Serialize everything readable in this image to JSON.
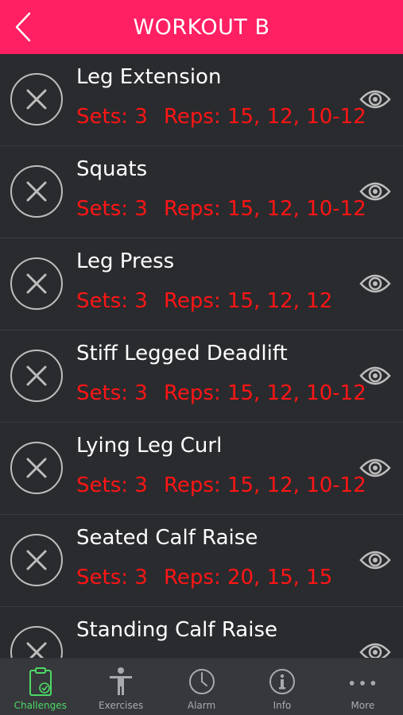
{
  "header": {
    "title": "WORKOUT B",
    "color": "#ff1f63"
  },
  "exercises": [
    {
      "name": "Leg Extension",
      "sets": "Sets: 3",
      "reps": "Reps: 15, 12, 10-12"
    },
    {
      "name": "Squats",
      "sets": "Sets: 3",
      "reps": "Reps: 15, 12, 10-12"
    },
    {
      "name": "Leg Press",
      "sets": "Sets: 3",
      "reps": "Reps: 15, 12, 12"
    },
    {
      "name": "Stiff Legged Deadlift",
      "sets": "Sets: 3",
      "reps": "Reps: 15, 12, 10-12"
    },
    {
      "name": "Lying Leg Curl",
      "sets": "Sets: 3",
      "reps": "Reps: 15, 12, 10-12"
    },
    {
      "name": "Seated Calf Raise",
      "sets": "Sets: 3",
      "reps": "Reps: 20, 15, 15"
    },
    {
      "name": "Standing Calf Raise",
      "sets": "",
      "reps": ""
    }
  ],
  "icons": {
    "back": "chevron-left-icon",
    "remove": "close-circle-icon",
    "view": "eye-icon"
  },
  "tabs": [
    {
      "label": "Challenges",
      "icon": "clipboard-check-icon",
      "active": true
    },
    {
      "label": "Exercises",
      "icon": "person-icon",
      "active": false
    },
    {
      "label": "Alarm",
      "icon": "clock-icon",
      "active": false
    },
    {
      "label": "Info",
      "icon": "info-icon",
      "active": false
    },
    {
      "label": "More",
      "icon": "more-dots-icon",
      "active": false
    }
  ],
  "colors": {
    "accent": "#ff1f63",
    "detail_text": "#ff1515",
    "active_tab": "#4cd964",
    "background": "#2a2b2e"
  }
}
